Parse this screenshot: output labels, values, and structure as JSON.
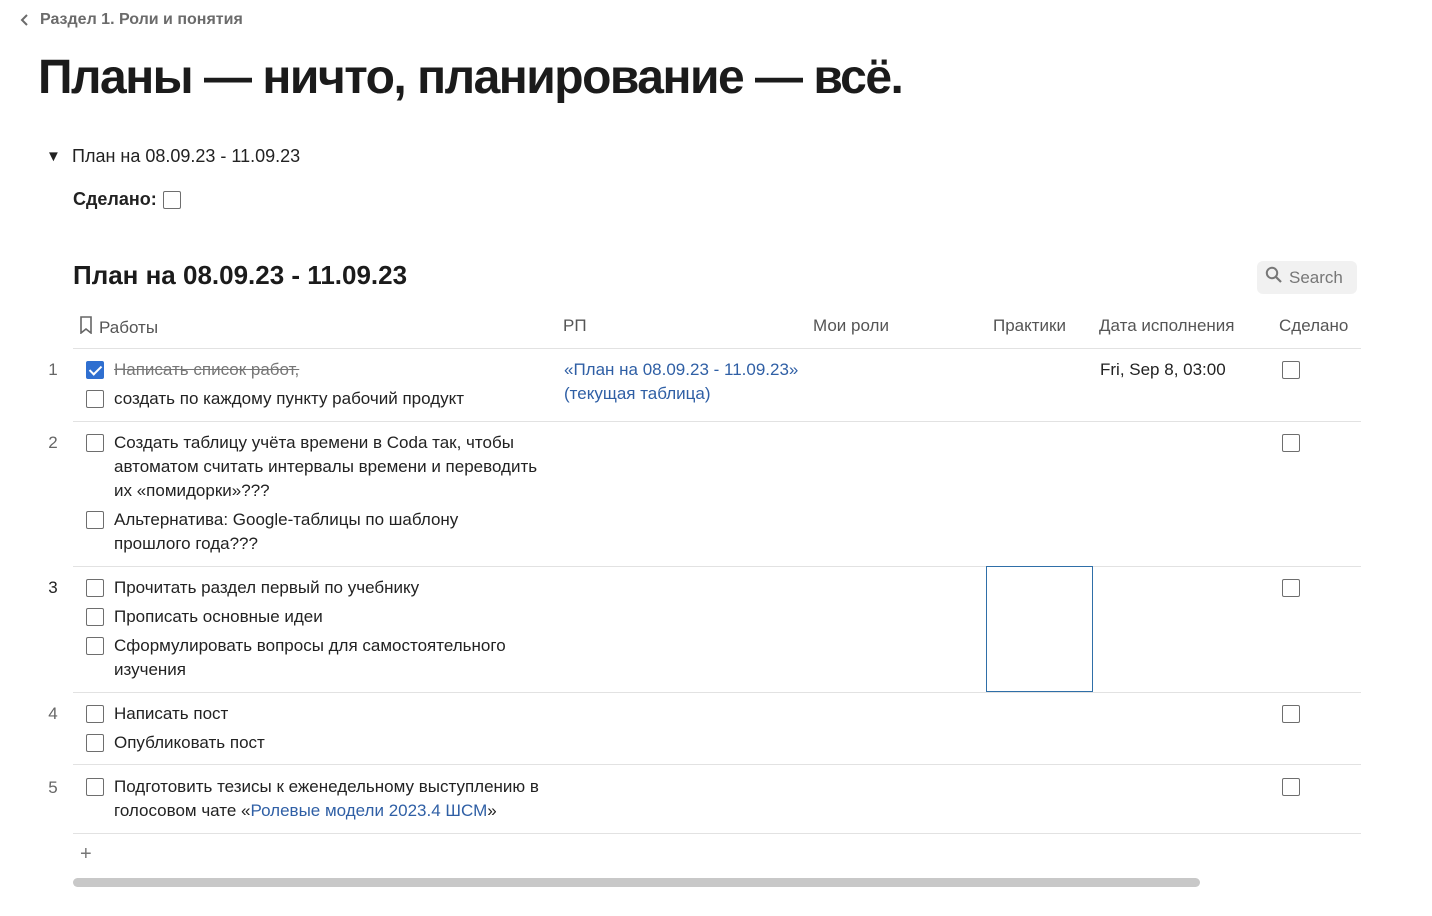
{
  "breadcrumb": {
    "label": "Раздел 1. Роли и понятия"
  },
  "page": {
    "title": "Планы — ничто, планирование — всё."
  },
  "toggle": {
    "label": "План на 08.09.23 - 11.09.23"
  },
  "done_field": {
    "label": "Сделано:"
  },
  "table": {
    "title": "План на 08.09.23 - 11.09.23",
    "search_label": "Search",
    "columns": {
      "works": "Работы",
      "rp": "РП",
      "roles": "Мои роли",
      "practices": "Практики",
      "due": "Дата исполнения",
      "done": "Сделано"
    },
    "rows": [
      {
        "num": "1",
        "tasks": [
          {
            "text": "Написать список работ,",
            "checked": true
          },
          {
            "text": "создать по каждому пункту рабочий продукт",
            "checked": false
          }
        ],
        "rp_line1": "«План на 08.09.23 - 11.09.23»",
        "rp_line2": "(текущая  таблица)",
        "due": "Fri, Sep 8, 03:00"
      },
      {
        "num": "2",
        "tasks": [
          {
            "text": "Создать таблицу учёта времени в Coda так, чтобы автоматом считать интервалы времени и переводить их «помидорки»???",
            "checked": false
          },
          {
            "text": "Альтернатива: Google-таблицы по шаблону прошлого года???",
            "checked": false
          }
        ]
      },
      {
        "num": "3",
        "tasks": [
          {
            "text": "Прочитать раздел первый по учебнику",
            "checked": false
          },
          {
            "text": "Прописать основные идеи",
            "checked": false
          },
          {
            "text": "Сформулировать вопросы для самостоятельного изучения",
            "checked": false
          }
        ]
      },
      {
        "num": "4",
        "tasks": [
          {
            "text": "Написать пост",
            "checked": false
          },
          {
            "text": "Опубликовать пост",
            "checked": false
          }
        ]
      },
      {
        "num": "5",
        "task_prefix": "Подготовить тезисы к еженедельному выступлению в голосовом чате «",
        "task_link": "Ролевые модели 2023.4 ШСМ",
        "task_suffix": "»"
      }
    ],
    "add_row_symbol": "+"
  },
  "icons": {
    "breadcrumb": "chevron-left-icon",
    "toggle": "triangle-down-icon",
    "search": "search-icon",
    "works_column": "bookmark-icon"
  },
  "colors": {
    "link": "#2f5fa5",
    "checkbox_checked": "#2f6fd0",
    "selection": "#2f6fa8"
  }
}
